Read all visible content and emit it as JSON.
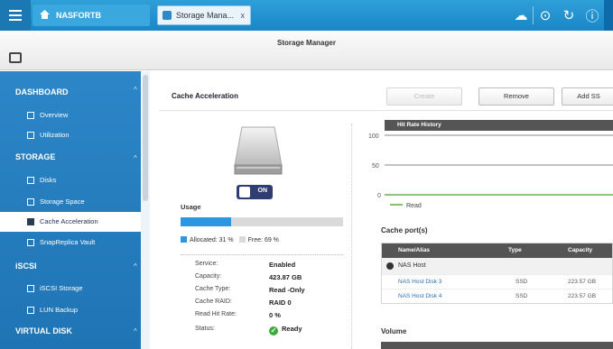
{
  "topbar": {
    "home_tab": "NASFORTB",
    "app_tab": "Storage Mana...",
    "app_tab_close": "x",
    "icons": [
      "cloud-icon",
      "play-icon",
      "refresh-icon",
      "info-icon"
    ]
  },
  "window": {
    "title": "Storage Manager"
  },
  "sidebar": {
    "sections": [
      {
        "label": "DASHBOARD",
        "items": [
          "Overview",
          "Utilization"
        ]
      },
      {
        "label": "STORAGE",
        "items": [
          "Disks",
          "Storage Space",
          "Cache Acceleration",
          "SnapReplica Vault"
        ]
      },
      {
        "label": "iSCSI",
        "items": [
          "iSCSI Storage",
          "LUN Backup"
        ]
      },
      {
        "label": "VIRTUAL DISK",
        "items": []
      }
    ],
    "active_item": "Cache Acceleration"
  },
  "main": {
    "section_title": "Cache Acceleration",
    "buttons": {
      "create": "Create",
      "remove": "Remove",
      "add_ssd": "Add SS"
    },
    "toggle_label": "ON",
    "usage": {
      "label": "Usage",
      "allocated_fraction": 0.31,
      "allocated_label": "Allocated: 31 %",
      "free_label": "Free: 69 %",
      "allocated_color": "#2d96df",
      "free_color": "#dadada"
    },
    "info": [
      {
        "key": "Service:",
        "value": "Enabled"
      },
      {
        "key": "Capacity:",
        "value": "423.87 GB"
      },
      {
        "key": "Cache Type:",
        "value": "Read -Only"
      },
      {
        "key": "Cache RAID:",
        "value": "RAID 0"
      },
      {
        "key": "Read Hit Rate:",
        "value": "0 %"
      },
      {
        "key": "Status:",
        "value": "Ready"
      }
    ],
    "hit_rate_chart": {
      "title": "Hit Rate History",
      "y_ticks": [
        "100",
        "50",
        "0"
      ],
      "legend": "Read"
    },
    "cache_ports": {
      "title": "Cache port(s)",
      "columns": [
        "Name/Alias",
        "Type",
        "Capacity"
      ],
      "group": "NAS Host",
      "rows": [
        {
          "name": "NAS Host Disk 3",
          "type": "SSD",
          "capacity": "223.57 GB"
        },
        {
          "name": "NAS Host Disk 4",
          "type": "SSD",
          "capacity": "223.57 GB"
        }
      ]
    },
    "volume_title": "Volume"
  }
}
